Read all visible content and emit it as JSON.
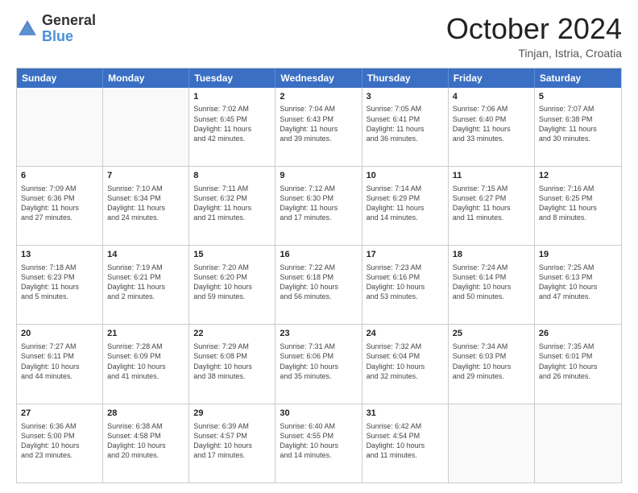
{
  "logo": {
    "general": "General",
    "blue": "Blue"
  },
  "header": {
    "month": "October 2024",
    "location": "Tinjan, Istria, Croatia"
  },
  "weekdays": [
    "Sunday",
    "Monday",
    "Tuesday",
    "Wednesday",
    "Thursday",
    "Friday",
    "Saturday"
  ],
  "rows": [
    [
      {
        "day": "",
        "lines": []
      },
      {
        "day": "",
        "lines": []
      },
      {
        "day": "1",
        "lines": [
          "Sunrise: 7:02 AM",
          "Sunset: 6:45 PM",
          "Daylight: 11 hours",
          "and 42 minutes."
        ]
      },
      {
        "day": "2",
        "lines": [
          "Sunrise: 7:04 AM",
          "Sunset: 6:43 PM",
          "Daylight: 11 hours",
          "and 39 minutes."
        ]
      },
      {
        "day": "3",
        "lines": [
          "Sunrise: 7:05 AM",
          "Sunset: 6:41 PM",
          "Daylight: 11 hours",
          "and 36 minutes."
        ]
      },
      {
        "day": "4",
        "lines": [
          "Sunrise: 7:06 AM",
          "Sunset: 6:40 PM",
          "Daylight: 11 hours",
          "and 33 minutes."
        ]
      },
      {
        "day": "5",
        "lines": [
          "Sunrise: 7:07 AM",
          "Sunset: 6:38 PM",
          "Daylight: 11 hours",
          "and 30 minutes."
        ]
      }
    ],
    [
      {
        "day": "6",
        "lines": [
          "Sunrise: 7:09 AM",
          "Sunset: 6:36 PM",
          "Daylight: 11 hours",
          "and 27 minutes."
        ]
      },
      {
        "day": "7",
        "lines": [
          "Sunrise: 7:10 AM",
          "Sunset: 6:34 PM",
          "Daylight: 11 hours",
          "and 24 minutes."
        ]
      },
      {
        "day": "8",
        "lines": [
          "Sunrise: 7:11 AM",
          "Sunset: 6:32 PM",
          "Daylight: 11 hours",
          "and 21 minutes."
        ]
      },
      {
        "day": "9",
        "lines": [
          "Sunrise: 7:12 AM",
          "Sunset: 6:30 PM",
          "Daylight: 11 hours",
          "and 17 minutes."
        ]
      },
      {
        "day": "10",
        "lines": [
          "Sunrise: 7:14 AM",
          "Sunset: 6:29 PM",
          "Daylight: 11 hours",
          "and 14 minutes."
        ]
      },
      {
        "day": "11",
        "lines": [
          "Sunrise: 7:15 AM",
          "Sunset: 6:27 PM",
          "Daylight: 11 hours",
          "and 11 minutes."
        ]
      },
      {
        "day": "12",
        "lines": [
          "Sunrise: 7:16 AM",
          "Sunset: 6:25 PM",
          "Daylight: 11 hours",
          "and 8 minutes."
        ]
      }
    ],
    [
      {
        "day": "13",
        "lines": [
          "Sunrise: 7:18 AM",
          "Sunset: 6:23 PM",
          "Daylight: 11 hours",
          "and 5 minutes."
        ]
      },
      {
        "day": "14",
        "lines": [
          "Sunrise: 7:19 AM",
          "Sunset: 6:21 PM",
          "Daylight: 11 hours",
          "and 2 minutes."
        ]
      },
      {
        "day": "15",
        "lines": [
          "Sunrise: 7:20 AM",
          "Sunset: 6:20 PM",
          "Daylight: 10 hours",
          "and 59 minutes."
        ]
      },
      {
        "day": "16",
        "lines": [
          "Sunrise: 7:22 AM",
          "Sunset: 6:18 PM",
          "Daylight: 10 hours",
          "and 56 minutes."
        ]
      },
      {
        "day": "17",
        "lines": [
          "Sunrise: 7:23 AM",
          "Sunset: 6:16 PM",
          "Daylight: 10 hours",
          "and 53 minutes."
        ]
      },
      {
        "day": "18",
        "lines": [
          "Sunrise: 7:24 AM",
          "Sunset: 6:14 PM",
          "Daylight: 10 hours",
          "and 50 minutes."
        ]
      },
      {
        "day": "19",
        "lines": [
          "Sunrise: 7:25 AM",
          "Sunset: 6:13 PM",
          "Daylight: 10 hours",
          "and 47 minutes."
        ]
      }
    ],
    [
      {
        "day": "20",
        "lines": [
          "Sunrise: 7:27 AM",
          "Sunset: 6:11 PM",
          "Daylight: 10 hours",
          "and 44 minutes."
        ]
      },
      {
        "day": "21",
        "lines": [
          "Sunrise: 7:28 AM",
          "Sunset: 6:09 PM",
          "Daylight: 10 hours",
          "and 41 minutes."
        ]
      },
      {
        "day": "22",
        "lines": [
          "Sunrise: 7:29 AM",
          "Sunset: 6:08 PM",
          "Daylight: 10 hours",
          "and 38 minutes."
        ]
      },
      {
        "day": "23",
        "lines": [
          "Sunrise: 7:31 AM",
          "Sunset: 6:06 PM",
          "Daylight: 10 hours",
          "and 35 minutes."
        ]
      },
      {
        "day": "24",
        "lines": [
          "Sunrise: 7:32 AM",
          "Sunset: 6:04 PM",
          "Daylight: 10 hours",
          "and 32 minutes."
        ]
      },
      {
        "day": "25",
        "lines": [
          "Sunrise: 7:34 AM",
          "Sunset: 6:03 PM",
          "Daylight: 10 hours",
          "and 29 minutes."
        ]
      },
      {
        "day": "26",
        "lines": [
          "Sunrise: 7:35 AM",
          "Sunset: 6:01 PM",
          "Daylight: 10 hours",
          "and 26 minutes."
        ]
      }
    ],
    [
      {
        "day": "27",
        "lines": [
          "Sunrise: 6:36 AM",
          "Sunset: 5:00 PM",
          "Daylight: 10 hours",
          "and 23 minutes."
        ]
      },
      {
        "day": "28",
        "lines": [
          "Sunrise: 6:38 AM",
          "Sunset: 4:58 PM",
          "Daylight: 10 hours",
          "and 20 minutes."
        ]
      },
      {
        "day": "29",
        "lines": [
          "Sunrise: 6:39 AM",
          "Sunset: 4:57 PM",
          "Daylight: 10 hours",
          "and 17 minutes."
        ]
      },
      {
        "day": "30",
        "lines": [
          "Sunrise: 6:40 AM",
          "Sunset: 4:55 PM",
          "Daylight: 10 hours",
          "and 14 minutes."
        ]
      },
      {
        "day": "31",
        "lines": [
          "Sunrise: 6:42 AM",
          "Sunset: 4:54 PM",
          "Daylight: 10 hours",
          "and 11 minutes."
        ]
      },
      {
        "day": "",
        "lines": []
      },
      {
        "day": "",
        "lines": []
      }
    ]
  ]
}
